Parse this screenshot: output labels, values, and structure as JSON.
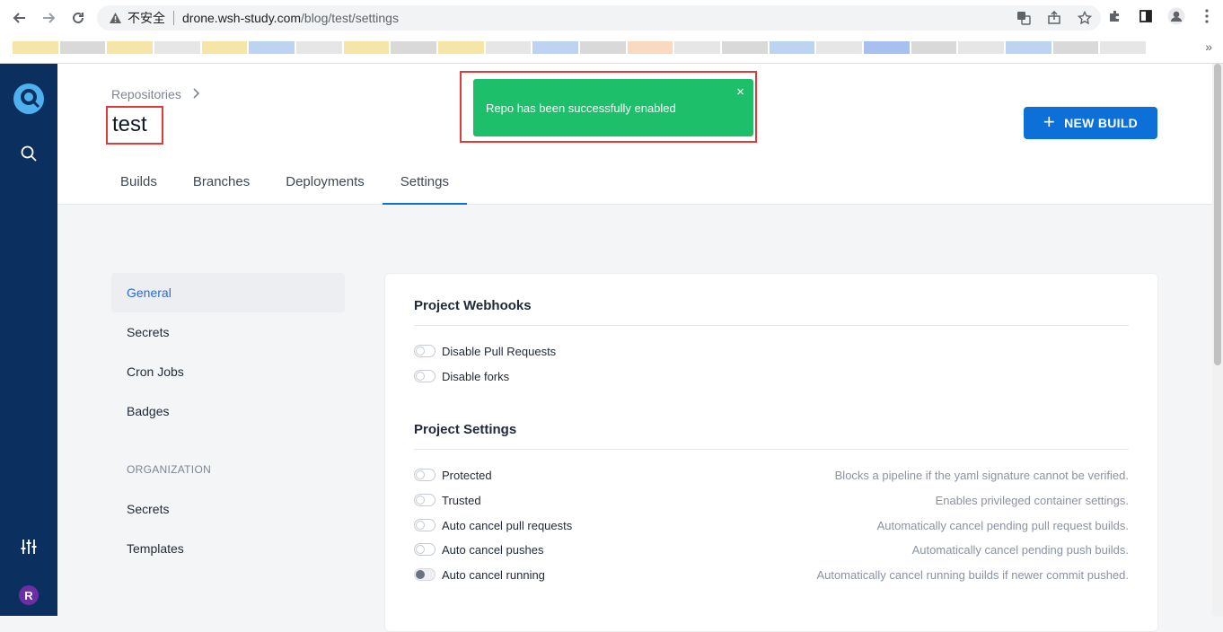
{
  "browser": {
    "insecure_label": "不安全",
    "url_host": "drone.wsh-study.com",
    "url_path": "/blog/test/settings",
    "more_bookmarks": "»"
  },
  "header": {
    "breadcrumb": "Repositories",
    "repo_name": "test",
    "new_build_label": "NEW BUILD"
  },
  "tabs": [
    {
      "label": "Builds"
    },
    {
      "label": "Branches"
    },
    {
      "label": "Deployments"
    },
    {
      "label": "Settings",
      "active": true
    }
  ],
  "toast": {
    "message": "Repo has been successfully enabled",
    "close": "×"
  },
  "settings_nav": {
    "items": [
      {
        "label": "General",
        "active": true
      },
      {
        "label": "Secrets"
      },
      {
        "label": "Cron Jobs"
      },
      {
        "label": "Badges"
      }
    ],
    "section_title": "ORGANIZATION",
    "org_items": [
      {
        "label": "Secrets"
      },
      {
        "label": "Templates"
      }
    ]
  },
  "webhooks": {
    "title": "Project Webhooks",
    "options": [
      {
        "label": "Disable Pull Requests",
        "enabled": false
      },
      {
        "label": "Disable forks",
        "enabled": false
      }
    ]
  },
  "project_settings": {
    "title": "Project Settings",
    "options": [
      {
        "label": "Protected",
        "description": "Blocks a pipeline if the yaml signature cannot be verified.",
        "enabled": false
      },
      {
        "label": "Trusted",
        "description": "Enables privileged container settings.",
        "enabled": false
      },
      {
        "label": "Auto cancel pull requests",
        "description": "Automatically cancel pending pull request builds.",
        "enabled": false
      },
      {
        "label": "Auto cancel pushes",
        "description": "Automatically cancel pending push builds.",
        "enabled": false
      },
      {
        "label": "Auto cancel running",
        "description": "Automatically cancel running builds if newer commit pushed.",
        "enabled": true
      }
    ]
  },
  "user": {
    "avatar_initial": "R"
  },
  "colors": {
    "sidebar": "#0b2f5e",
    "accent": "#0d6fd8",
    "toast": "#1dbf6a",
    "highlight_outline": "#e03a3a"
  }
}
